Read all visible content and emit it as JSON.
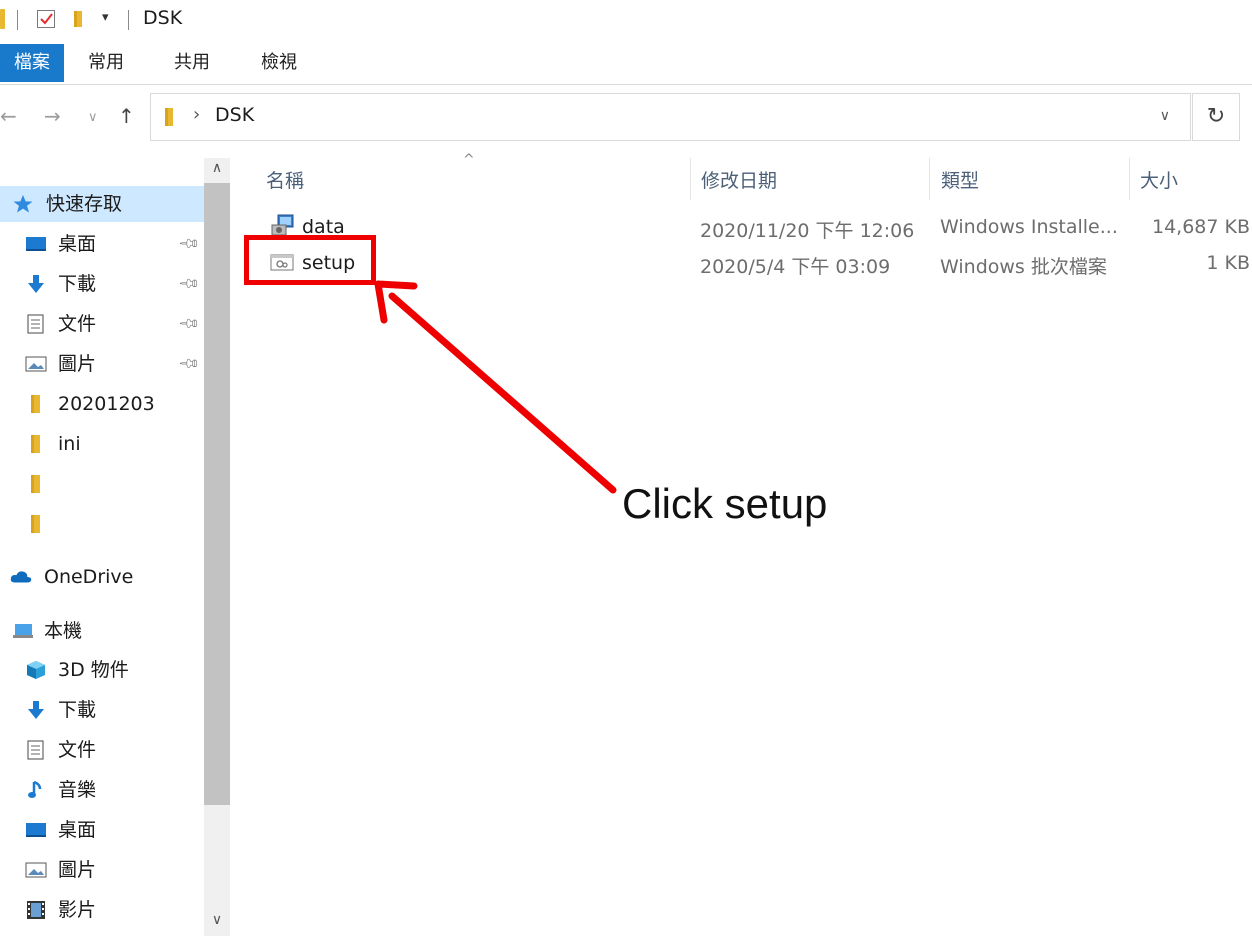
{
  "window": {
    "title": "DSK"
  },
  "ribbon": {
    "tabs": [
      "檔案",
      "常用",
      "共用",
      "檢視"
    ]
  },
  "address_bar": {
    "path": "DSK"
  },
  "nav_pane": {
    "quick_access": "快速存取",
    "items": [
      {
        "label": "桌面",
        "icon": "desktop-icon",
        "pinned": true
      },
      {
        "label": "下載",
        "icon": "download-icon",
        "pinned": true
      },
      {
        "label": "文件",
        "icon": "document-icon",
        "pinned": true
      },
      {
        "label": "圖片",
        "icon": "picture-icon",
        "pinned": true
      },
      {
        "label": "20201203",
        "icon": "folder-icon",
        "pinned": false
      },
      {
        "label": "ini",
        "icon": "folder-icon",
        "pinned": false
      },
      {
        "label": "",
        "icon": "folder-icon",
        "pinned": false
      },
      {
        "label": "",
        "icon": "folder-icon",
        "pinned": false
      }
    ],
    "onedrive": "OneDrive",
    "this_pc": "本機",
    "pc_items": [
      {
        "label": "3D 物件",
        "icon": "cube-icon"
      },
      {
        "label": "下載",
        "icon": "download-icon"
      },
      {
        "label": "文件",
        "icon": "document-icon"
      },
      {
        "label": "音樂",
        "icon": "music-icon"
      },
      {
        "label": "桌面",
        "icon": "desktop-icon"
      },
      {
        "label": "圖片",
        "icon": "picture-icon"
      },
      {
        "label": "影片",
        "icon": "video-icon"
      }
    ]
  },
  "file_list": {
    "columns": [
      "名稱",
      "修改日期",
      "類型",
      "大小"
    ],
    "rows": [
      {
        "name": "data",
        "modified": "2020/11/20 下午 12:06",
        "type": "Windows Installe...",
        "size": "14,687 KB",
        "icon": "installer-icon"
      },
      {
        "name": "setup",
        "modified": "2020/5/4 下午 03:09",
        "type": "Windows 批次檔案",
        "size": "1 KB",
        "icon": "batch-file-icon"
      }
    ]
  },
  "annotation": {
    "text": "Click setup",
    "color": "#ee0000"
  }
}
